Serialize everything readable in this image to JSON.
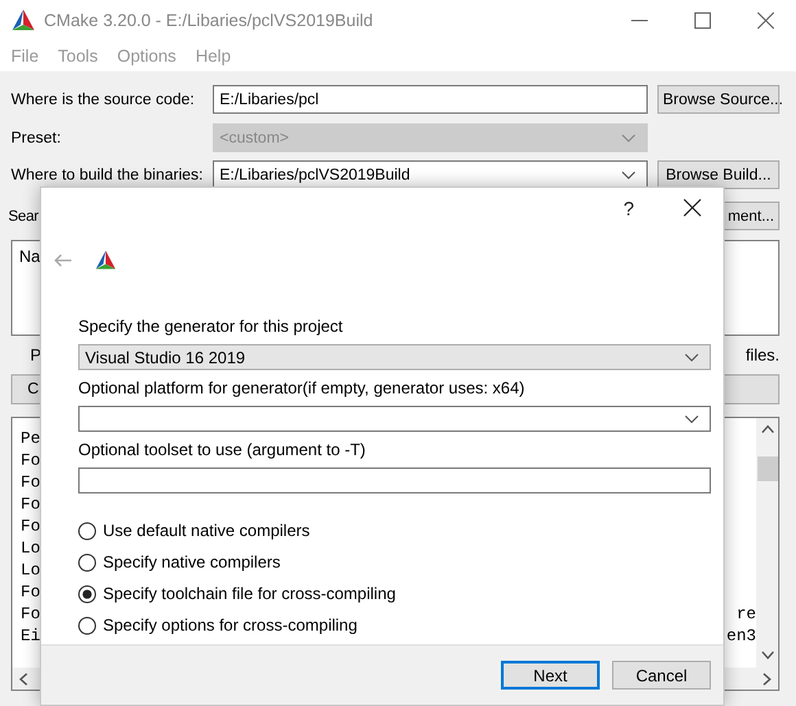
{
  "window": {
    "title": "CMake 3.20.0 - E:/Libaries/pclVS2019Build"
  },
  "menu": [
    "File",
    "Tools",
    "Options",
    "Help"
  ],
  "source": {
    "label": "Where is the source code:",
    "value": "E:/Libaries/pcl",
    "button": "Browse Source..."
  },
  "preset": {
    "label": "Preset:",
    "value": "<custom>",
    "disabled": true
  },
  "build": {
    "label": "Where to build the binaries:",
    "value": "E:/Libaries/pclVS2019Build",
    "button": "Browse Build..."
  },
  "search": {
    "label": "Sear",
    "button": "ment..."
  },
  "list": {
    "header": "Na"
  },
  "hint": {
    "left": "P",
    "right": "files."
  },
  "configure_button": "C",
  "log": [
    {
      "left": "Pe"
    },
    {
      "left": "Fo"
    },
    {
      "left": "Fo"
    },
    {
      "left": "Fo"
    },
    {
      "left": "Fo"
    },
    {
      "left": "Lo"
    },
    {
      "left": "Lo"
    },
    {
      "left": "Fo"
    },
    {
      "left": "Fo",
      "right": "re"
    },
    {
      "left": "Ei",
      "right": "en3"
    }
  ],
  "dialog": {
    "help": "?",
    "generator_label": "Specify the generator for this project",
    "generator": "Visual Studio 16 2019",
    "platform_label": "Optional platform for generator(if empty, generator uses: x64)",
    "toolset_label": "Optional toolset to use (argument to -T)",
    "options": [
      {
        "label": "Use default native compilers",
        "selected": false
      },
      {
        "label": "Specify native compilers",
        "selected": false
      },
      {
        "label": "Specify toolchain file for cross-compiling",
        "selected": true
      },
      {
        "label": "Specify options for cross-compiling",
        "selected": false
      }
    ],
    "buttons": [
      {
        "label": "Next",
        "default": true
      },
      {
        "label": "Cancel",
        "default": false
      }
    ]
  }
}
